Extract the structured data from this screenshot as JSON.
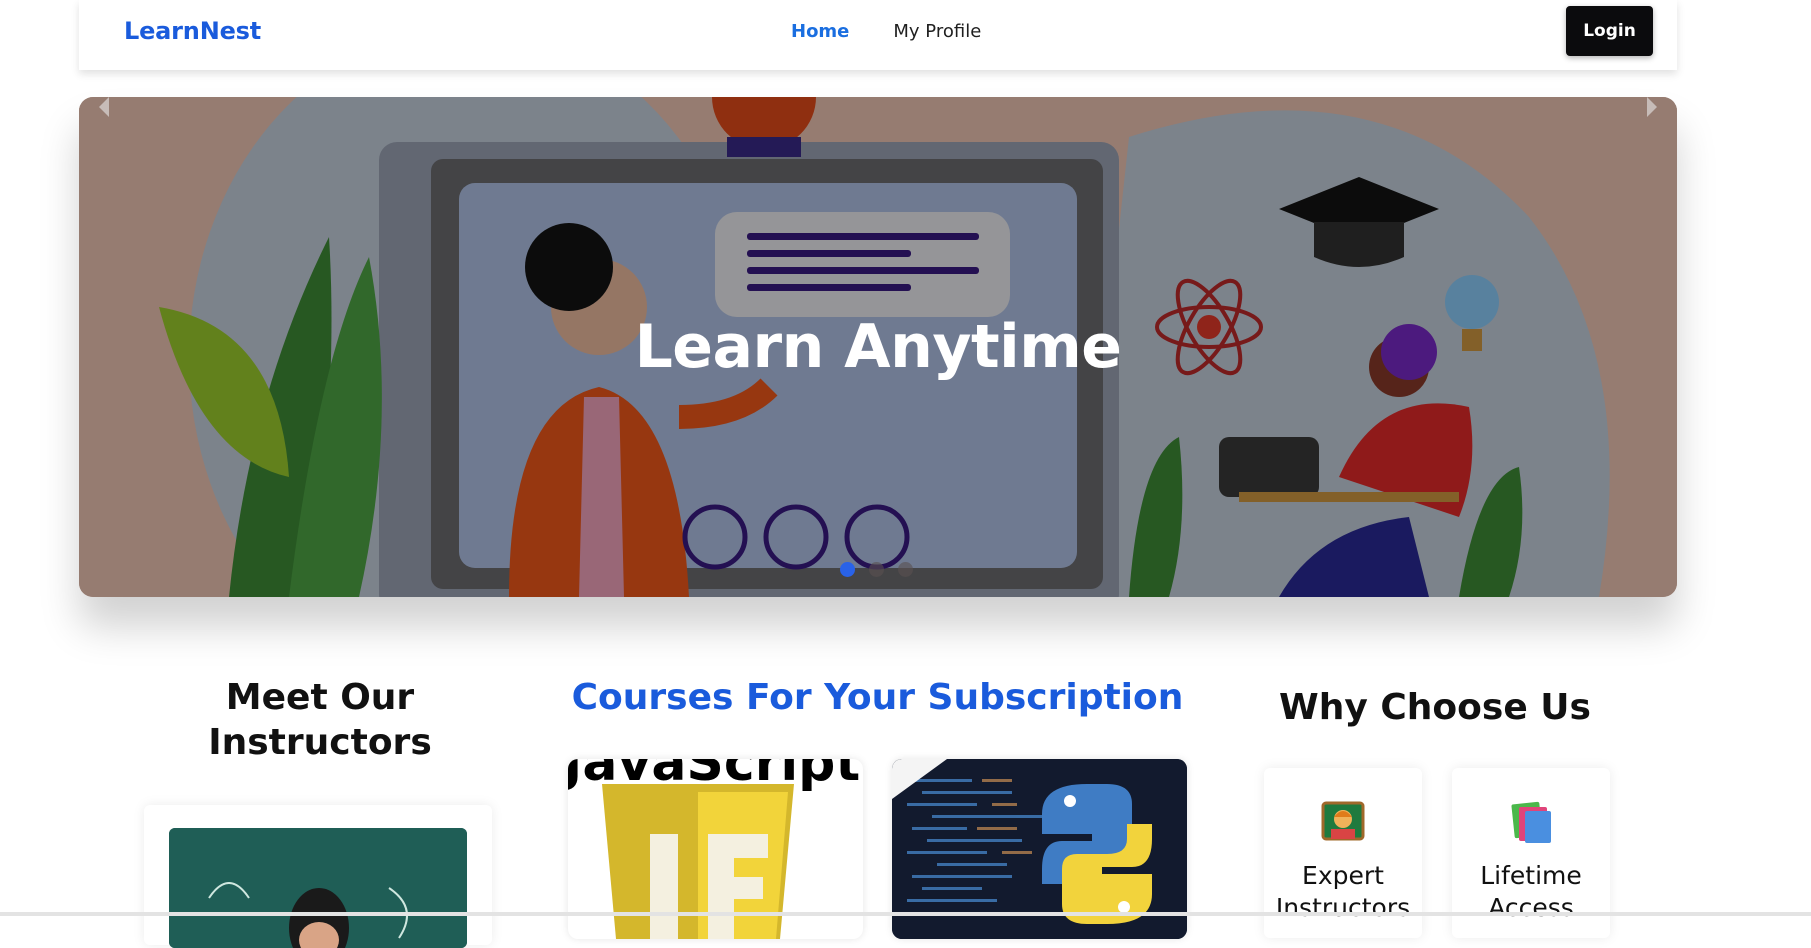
{
  "navbar": {
    "brand": "LearnNest",
    "links": [
      {
        "label": "Home",
        "active": true
      },
      {
        "label": "My Profile",
        "active": false
      }
    ],
    "login_label": "Login"
  },
  "hero": {
    "title": "Learn Anytime",
    "slide_count": 3,
    "active_slide": 1
  },
  "sections": {
    "instructors_title": "Meet Our Instructors",
    "courses_title": "Courses For Your Subscription",
    "why_title": "Why Choose Us"
  },
  "courses": [
    {
      "name": "JavaScript",
      "thumb_text": "JavaScript"
    },
    {
      "name": "Python"
    }
  ],
  "why_items": [
    {
      "label": "Expert Instructors",
      "icon": "teacher-emoji"
    },
    {
      "label": "Lifetime Access",
      "icon": "books-emoji"
    }
  ],
  "colors": {
    "brand": "#1a5bdc",
    "nav_active": "#1a6ee0",
    "login_bg": "#0b0b0d",
    "dot_active": "#2962e8"
  }
}
